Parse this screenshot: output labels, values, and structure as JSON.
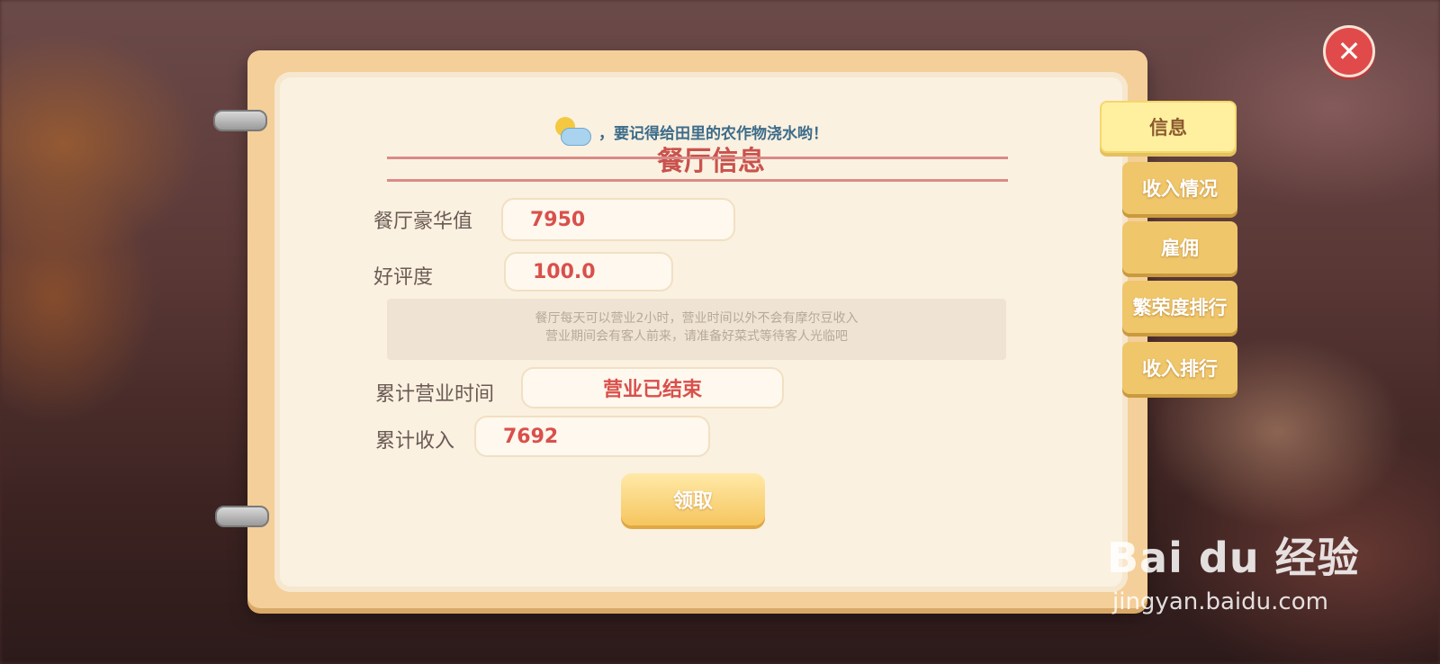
{
  "window": {
    "close_label": "✕"
  },
  "tip": {
    "text": "，要记得给田里的农作物浇水哟！"
  },
  "panel": {
    "title": "餐厅信息",
    "luxury_label": "餐厅豪华值",
    "luxury_value": "7950",
    "rating_label": "好评度",
    "rating_value": "100.0",
    "note_line1": "餐厅每天可以营业2小时，营业时间以外不会有摩尔豆收入",
    "note_line2": "营业期间会有客人前来，请准备好菜式等待客人光临吧",
    "hours_label": "累计营业时间",
    "hours_value": "营业已结束",
    "income_label": "累计收入",
    "income_value": "7692",
    "claim_label": "领取"
  },
  "tabs": [
    {
      "label": "信息",
      "active": true
    },
    {
      "label": "收入情况",
      "active": false
    },
    {
      "label": "雇佣",
      "active": false
    },
    {
      "label": "繁荣度排行",
      "active": false
    },
    {
      "label": "收入排行",
      "active": false
    }
  ],
  "watermark": {
    "brand": "Bai du 经验",
    "url": "jingyan.baidu.com"
  },
  "colors": {
    "accent": "#d9504c",
    "tab": "#f0c66a",
    "paper": "#fbf1e0"
  }
}
